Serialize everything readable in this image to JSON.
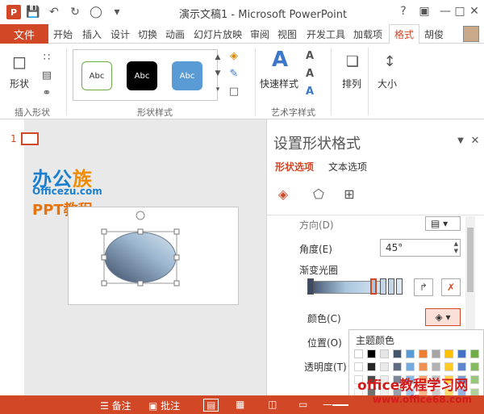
{
  "window": {
    "app_icon": "P",
    "title": "演示文稿1 - Microsoft PowerPoint"
  },
  "tabs": {
    "file": "文件",
    "items": [
      "开始",
      "插入",
      "设计",
      "切换",
      "动画",
      "幻灯片放映",
      "审阅",
      "视图",
      "开发工具",
      "加载项",
      "格式"
    ],
    "user": "胡俊"
  },
  "ribbon": {
    "insert_shape": {
      "shape_button": "形状",
      "group_label": "插入形状"
    },
    "shape_styles": {
      "samples": [
        "Abc",
        "Abc",
        "Abc"
      ],
      "group_label": "形状样式"
    },
    "wordart": {
      "quick_styles": "快速样式",
      "group_label": "艺术字样式"
    },
    "arrange": "排列",
    "size": "大小"
  },
  "slides": {
    "number": "1",
    "logo_main_a": "办公",
    "logo_main_b": "族",
    "logo_sub": "Officezu.com",
    "logo_ppt": "PPT教程"
  },
  "format_pane": {
    "title": "设置形状格式",
    "tab_shape": "形状选项",
    "tab_text": "文本选项",
    "direction": "方向(D)",
    "angle_label": "角度(E)",
    "angle_value": "45°",
    "gradient_stops": "渐变光圈",
    "color_label": "颜色(C)",
    "position_label": "位置(O)",
    "transparency_label": "透明度(T)"
  },
  "color_popup": {
    "title": "主题颜色",
    "colors": [
      "#ffffff",
      "#000000",
      "#e7e6e6",
      "#44546a",
      "#5b9bd5",
      "#ed7d31",
      "#a5a5a5",
      "#ffc000",
      "#4472c4",
      "#70ad47"
    ]
  },
  "status_bar": {
    "notes": "备注",
    "comments": "批注"
  },
  "watermark": {
    "line1": "office教程学习网",
    "line2": "www.office68.com"
  }
}
